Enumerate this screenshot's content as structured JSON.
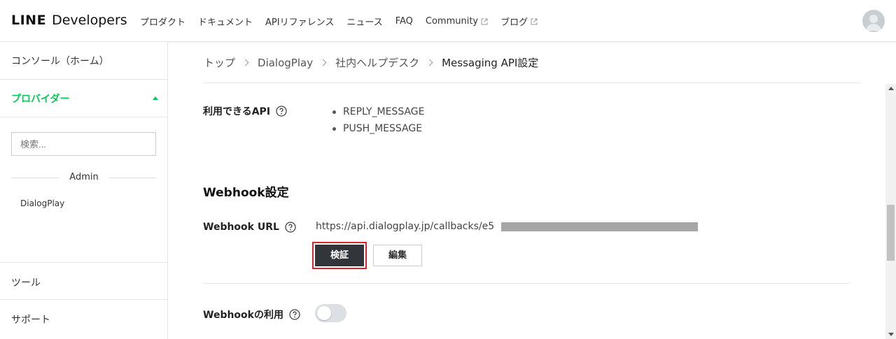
{
  "header": {
    "logo_line": "LINE",
    "logo_dev": "Developers",
    "nav": [
      {
        "label": "プロダクト"
      },
      {
        "label": "ドキュメント"
      },
      {
        "label": "APIリファレンス"
      },
      {
        "label": "ニュース"
      },
      {
        "label": "FAQ"
      },
      {
        "label": "Community"
      },
      {
        "label": "ブログ"
      }
    ]
  },
  "sidebar": {
    "console": "コンソール（ホーム）",
    "provider": "プロバイダー",
    "search_placeholder": "検索...",
    "admin_label": "Admin",
    "provider_item": "DialogPlay",
    "tool": "ツール",
    "support": "サポート"
  },
  "breadcrumb": {
    "items": [
      "トップ",
      "DialogPlay",
      "社内ヘルプデスク",
      "Messaging API設定"
    ]
  },
  "api": {
    "label": "利用できるAPI",
    "items": [
      "REPLY_MESSAGE",
      "PUSH_MESSAGE"
    ]
  },
  "webhook": {
    "section_title": "Webhook設定",
    "url_label": "Webhook URL",
    "url_value": "https://api.dialogplay.jp/callbacks/e5",
    "verify_label": "検証",
    "edit_label": "編集",
    "use_label": "Webhookの利用",
    "use_enabled": false
  },
  "colors": {
    "accent": "#06c755",
    "highlight_border": "#d9232d",
    "button_dark": "#32363a"
  }
}
